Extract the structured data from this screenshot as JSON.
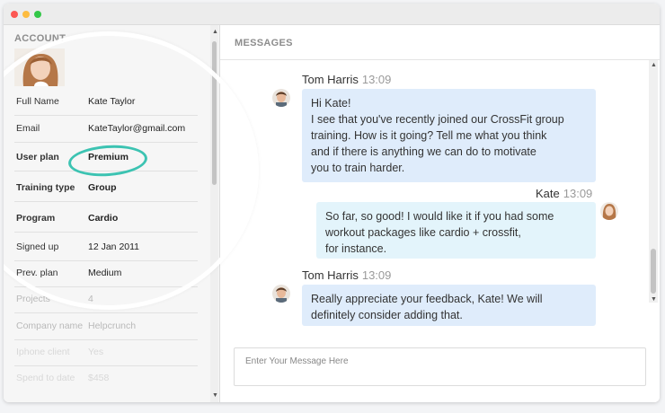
{
  "account": {
    "title": "ACCOUNT",
    "rows": [
      {
        "label": "Full Name",
        "value": "Kate Taylor"
      },
      {
        "label": "Email",
        "value": "KateTaylor@gmail.com"
      },
      {
        "label": "User plan",
        "value": "Premium"
      },
      {
        "label": "Training type",
        "value": "Group"
      },
      {
        "label": "Program",
        "value": "Cardio"
      },
      {
        "label": "Signed up",
        "value": "12 Jan 2011"
      },
      {
        "label": "Prev. plan",
        "value": "Medium"
      },
      {
        "label": "Projects",
        "value": "4"
      },
      {
        "label": "Company name",
        "value": "Helpcrunch"
      },
      {
        "label": "Iphone client",
        "value": "Yes"
      },
      {
        "label": "Spend to date",
        "value": "$458"
      }
    ]
  },
  "messages": {
    "title": "MESSAGES",
    "items": [
      {
        "sender": "Tom Harris",
        "time": "13:09",
        "lines": [
          "Hi Kate!",
          "I see that you've recently joined our CrossFit group",
          "training. How is it going? Tell me what you think",
          "and if there is anything we can do to motivate",
          "you to train harder."
        ]
      },
      {
        "sender": "Kate",
        "time": "13:09",
        "lines": [
          "So far, so good! I would like it if you had some",
          "workout packages like cardio + crossfit,",
          "for instance."
        ]
      },
      {
        "sender": "Tom Harris",
        "time": "13:09",
        "lines": [
          "Really appreciate your feedback, Kate! We will",
          "definitely consider adding that."
        ]
      }
    ],
    "compose_placeholder": "Enter Your Message Here"
  },
  "colors": {
    "accent_ring": "#3cc3b2",
    "bubble_incoming": "#dfecfb",
    "bubble_outgoing": "#e3f4fb"
  }
}
